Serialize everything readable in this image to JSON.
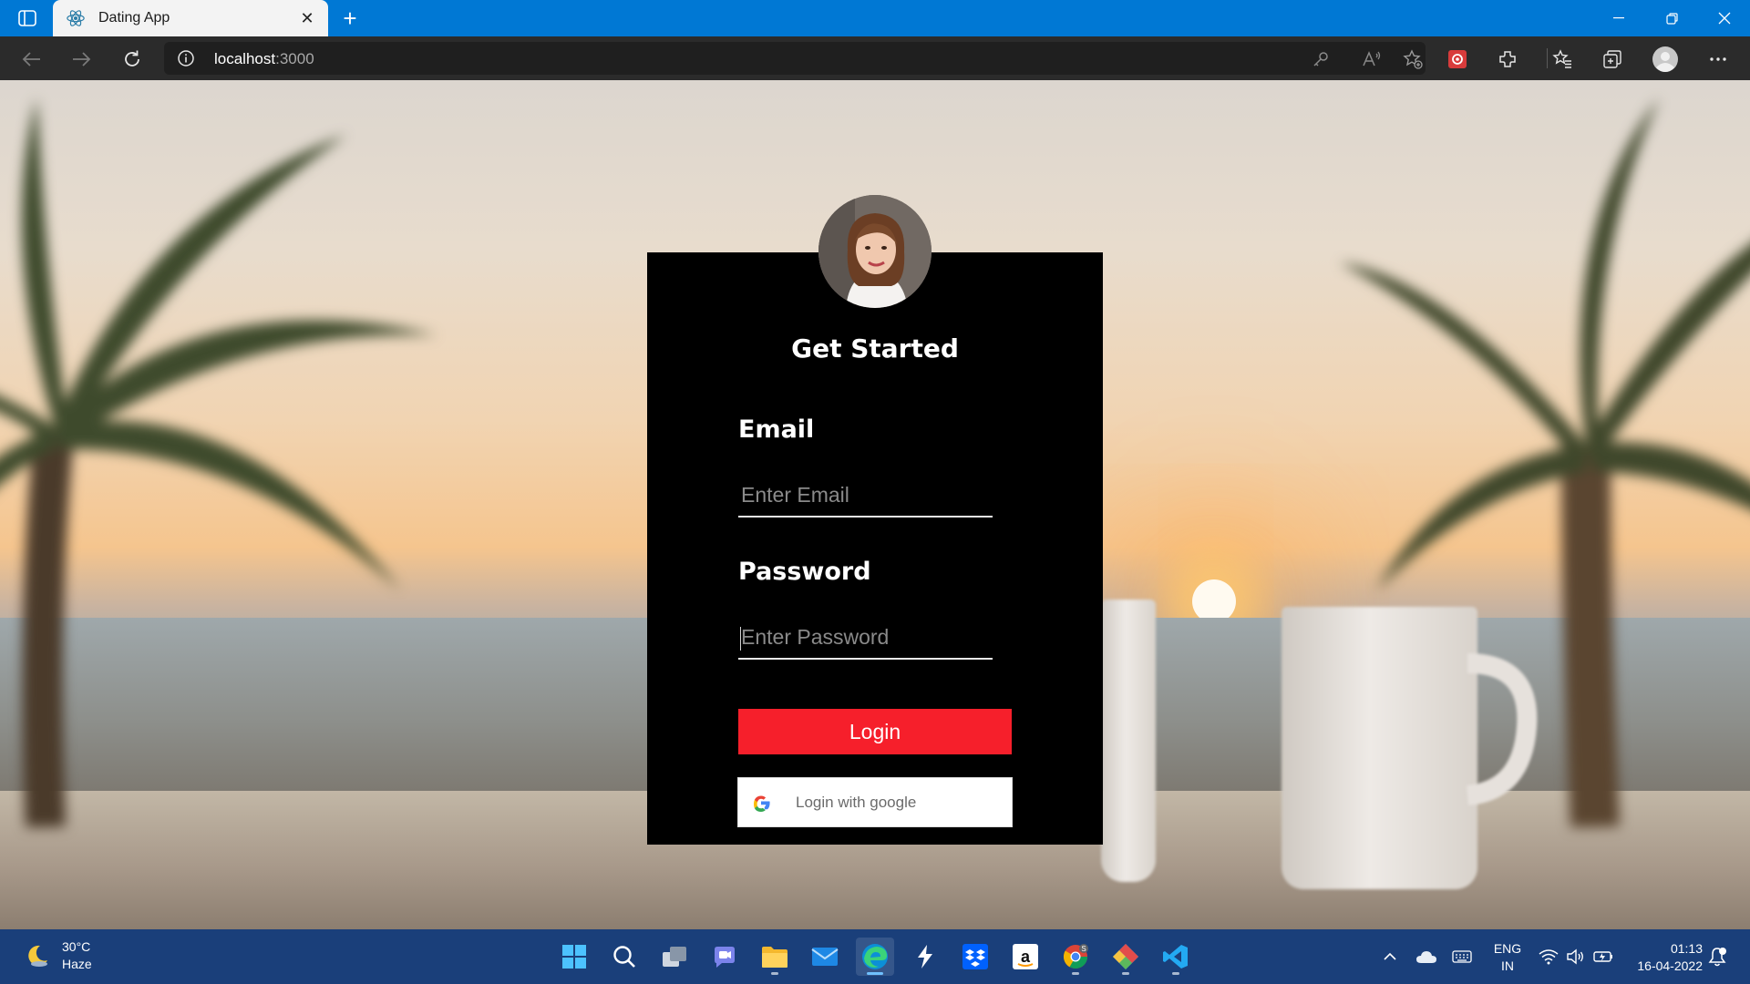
{
  "browser": {
    "tab_title": "Dating App",
    "address_host": "localhost",
    "address_port": ":3000"
  },
  "login": {
    "title": "Get Started",
    "email_label": "Email",
    "email_placeholder": "Enter Email",
    "password_label": "Password",
    "password_placeholder": "Enter Password",
    "login_button": "Login",
    "google_button": "Login with google"
  },
  "taskbar": {
    "weather_temp": "30°C",
    "weather_desc": "Haze",
    "language_top": "ENG",
    "language_bottom": "IN",
    "time": "01:13",
    "date": "16-04-2022",
    "apps": [
      "windows-start",
      "search",
      "task-view",
      "teams-chat",
      "file-explorer",
      "mail",
      "edge",
      "visual-studio",
      "dropbox",
      "amazon",
      "chrome",
      "git",
      "vscode"
    ]
  },
  "colors": {
    "titlebar": "#0078d4",
    "toolbar": "#2b2b2b",
    "card_background": "#000000",
    "login_button": "#f61f2b",
    "taskbar": "#1a3f7a"
  }
}
